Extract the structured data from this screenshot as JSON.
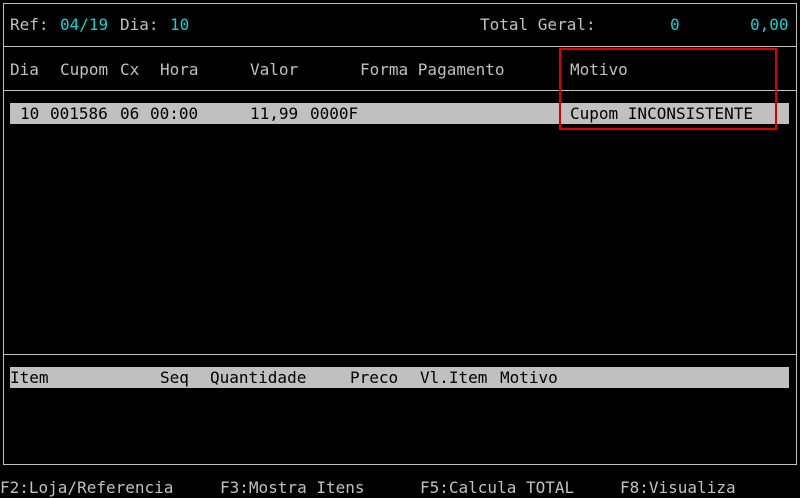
{
  "header": {
    "ref_label": "Ref:",
    "ref_value": "04/19",
    "dia_label": "Dia:",
    "dia_value": "10",
    "total_label": "Total Geral:",
    "total_count": "0",
    "total_value": "0,00"
  },
  "columns": {
    "dia": "Dia",
    "cupom": "Cupom",
    "cx": "Cx",
    "hora": "Hora",
    "valor": "Valor",
    "forma": "Forma Pagamento",
    "motivo": "Motivo"
  },
  "rows": [
    {
      "dia": "10",
      "cupom": "001586",
      "cx": "06",
      "hora": "00:00",
      "valor": "11,99",
      "forma": "0000F",
      "motivo": "Cupom INCONSISTENTE"
    }
  ],
  "item_columns": {
    "item": "Item",
    "seq": "Seq",
    "quantidade": "Quantidade",
    "preco": "Preco",
    "vl_item": "Vl.Item",
    "motivo": "Motivo"
  },
  "function_keys": {
    "f2": "F2:Loja/Referencia",
    "f3": "F3:Mostra Itens",
    "f5": "F5:Calcula TOTAL",
    "f8": "F8:Visualiza"
  },
  "colors": {
    "background": "#000000",
    "text": "#c0c0c0",
    "highlight_value": "#00d8d8",
    "selected_row": "#c0c0c0",
    "annotation_box": "#e00000"
  }
}
